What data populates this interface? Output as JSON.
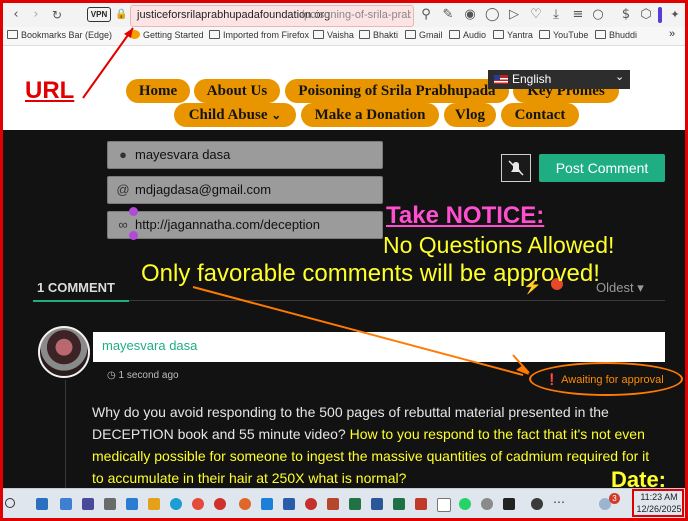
{
  "browser": {
    "url_host": "justiceforsrilaprabhupadafoundation.org",
    "url_path": "/poisoning-of-srila-prabhu",
    "vpn_label": "VPN",
    "bookmarks": [
      "Bookmarks Bar (Edge)",
      "Getting Started",
      "Imported from Firefox",
      "Vaisha",
      "Bhakti",
      "Gmail",
      "Audio",
      "Yantra",
      "YouTube",
      "Bhuddi"
    ],
    "more_bookmarks": "»"
  },
  "nav": {
    "items": [
      "Home",
      "About Us",
      "Poisoning of Srila Prabhupada",
      "Key Promes",
      "Child Abuse",
      "Make a Donation",
      "Vlog",
      "Contact"
    ],
    "child_abuse_caret": "⌄",
    "language": "English",
    "language_caret": "⌄"
  },
  "form": {
    "name_value": "mayesvara dasa",
    "email_value": "mdjagdasa@gmail.com",
    "website_value": "http://jagannatha.com/deception",
    "post_button": "Post Comment"
  },
  "annotations": {
    "url_label": "URL",
    "notice_title": "Take NOTICE:",
    "notice_line1": "No Questions Allowed!",
    "notice_line2": "Only favorable comments will be approved!",
    "date_label": "Date:"
  },
  "comments": {
    "count_label": "1 COMMENT",
    "sort_label": "Oldest",
    "author": "mayesvara dasa",
    "time": "1 second ago",
    "status": "Awaiting for approval",
    "body_part1": "Why do you avoid responding to the 500 pages of rebuttal material presented in the DECEPTION book and 55 minute video? ",
    "body_highlight": "How to you respond to the fact that it's not even medically possible for someone to ingest the massive quantities of cadmium required for it to accumulate in their hair at 250X what is normal?"
  },
  "taskbar": {
    "time": "11:23 AM",
    "date": "12/26/2025",
    "notifications": "3"
  },
  "colors": {
    "accent_orange": "#e89500",
    "accent_green": "#1fae84",
    "annotation_red": "#e00000",
    "annotation_yellow": "#ffff2a",
    "annotation_pink": "#ff4fd0"
  }
}
